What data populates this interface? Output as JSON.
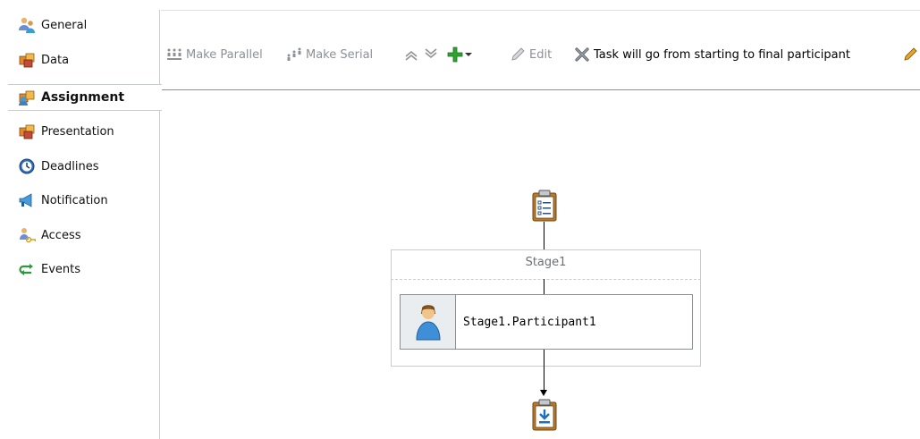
{
  "sidebar": {
    "items": [
      {
        "label": "General",
        "icon": "people-icon"
      },
      {
        "label": "Data",
        "icon": "boxes-icon"
      },
      {
        "label": "Assignment",
        "icon": "assignment-icon",
        "selected": true
      },
      {
        "label": "Presentation",
        "icon": "boxes-icon"
      },
      {
        "label": "Deadlines",
        "icon": "clock-icon"
      },
      {
        "label": "Notification",
        "icon": "megaphone-icon"
      },
      {
        "label": "Access",
        "icon": "key-user-icon"
      },
      {
        "label": "Events",
        "icon": "events-icon"
      }
    ]
  },
  "toolbar": {
    "make_parallel": "Make Parallel",
    "make_serial": "Make Serial",
    "edit": "Edit",
    "routing": "Task will go from starting to final participant"
  },
  "canvas": {
    "stage_title": "Stage1",
    "participant_label": "Stage1.Participant1"
  },
  "colors": {
    "accent_green": "#2fa32f",
    "disabled_text": "#8d9096",
    "border": "#c8cbcf"
  }
}
